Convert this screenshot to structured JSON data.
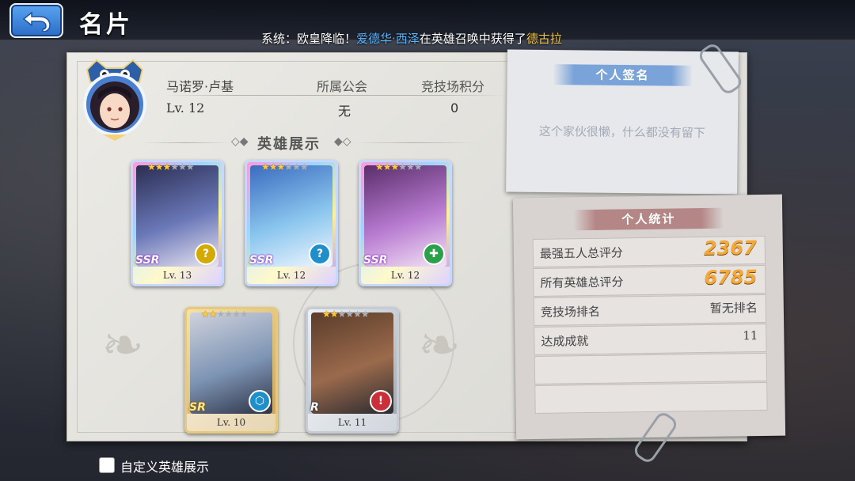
{
  "header": {
    "title": "名片",
    "broadcast": {
      "prefix": "系统：欧皇降临！",
      "player": "爱德华·西泽",
      "middle": "在英雄召唤中获得了",
      "hero": "德古拉"
    }
  },
  "profile": {
    "name": "马诺罗·卢基",
    "level": "Lv. 12",
    "guild_label": "所属公会",
    "guild_value": "无",
    "arena_label": "竞技场积分",
    "arena_value": "0"
  },
  "showcase": {
    "title": "英雄展示",
    "heroes": [
      {
        "rarity": "SSR",
        "stars": 3,
        "level": "Lv. 13",
        "class_icon": "question-icon",
        "class_symbol": "?",
        "badge_color": "#d4a900"
      },
      {
        "rarity": "SSR",
        "stars": 3,
        "level": "Lv. 12",
        "class_icon": "question-icon",
        "class_symbol": "?",
        "badge_color": "#1f8fc9"
      },
      {
        "rarity": "SSR",
        "stars": 3,
        "level": "Lv. 12",
        "class_icon": "cross-icon",
        "class_symbol": "✚",
        "badge_color": "#2aa04a"
      },
      {
        "rarity": "SR",
        "stars": 2,
        "level": "Lv. 10",
        "class_icon": "shield-icon",
        "class_symbol": "⬡",
        "badge_color": "#1f8fc9"
      },
      {
        "rarity": "R",
        "stars": 2,
        "level": "Lv. 11",
        "class_icon": "sword-icon",
        "class_symbol": "!",
        "badge_color": "#c9303a"
      }
    ]
  },
  "signature": {
    "title": "个人签名",
    "text": "这个家伙很懒，什么都没有留下"
  },
  "stats": {
    "title": "个人统计",
    "rows": [
      {
        "label": "最强五人总评分",
        "value": "2367"
      },
      {
        "label": "所有英雄总评分",
        "value": "6785"
      },
      {
        "label": "竞技场排名",
        "value": "暂无排名"
      },
      {
        "label": "达成成就",
        "value": "11"
      },
      {
        "label": "",
        "value": ""
      },
      {
        "label": "",
        "value": ""
      }
    ]
  },
  "custom_showcase_label": "自定义英雄展示"
}
